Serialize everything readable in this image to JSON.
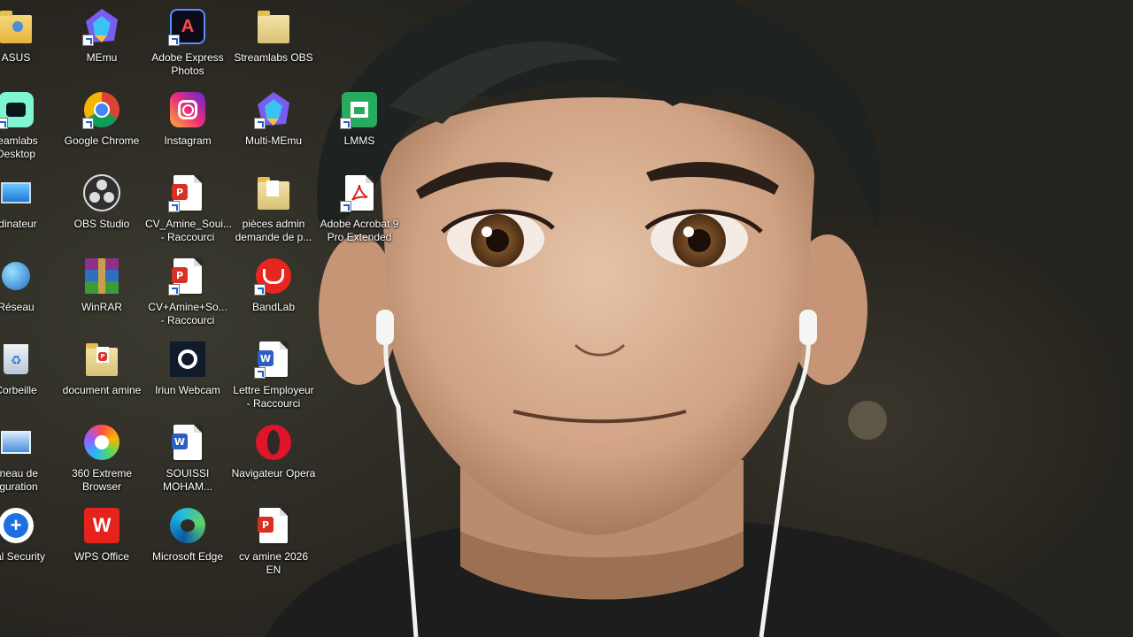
{
  "desktop": {
    "icons": [
      {
        "label": "ASUS",
        "icon": "user-folder-icon"
      },
      {
        "label": "MEmu",
        "icon": "memu-icon"
      },
      {
        "label": "Adobe Express\nPhotos",
        "icon": "adobe-express-icon"
      },
      {
        "label": "Streamlabs OBS",
        "icon": "folder-icon"
      },
      {
        "label": "reamlabs\nDesktop",
        "icon": "streamlabs-icon"
      },
      {
        "label": "Google Chrome",
        "icon": "chrome-icon"
      },
      {
        "label": "Instagram",
        "icon": "instagram-icon"
      },
      {
        "label": "Multi-MEmu",
        "icon": "memu-icon"
      },
      {
        "label": "LMMS",
        "icon": "lmms-icon"
      },
      {
        "label": "rdinateur",
        "icon": "computer-icon"
      },
      {
        "label": "OBS Studio",
        "icon": "obs-icon"
      },
      {
        "label": "CV_Amine_Soui...\n- Raccourci",
        "icon": "pdf-document-icon"
      },
      {
        "label": "pièces admin\ndemande de p...",
        "icon": "folder-icon"
      },
      {
        "label": "Adobe Acrobat 9\nPro Extended",
        "icon": "acrobat-icon"
      },
      {
        "label": "Réseau",
        "icon": "network-icon"
      },
      {
        "label": "WinRAR",
        "icon": "winrar-icon"
      },
      {
        "label": "CV+Amine+So...\n- Raccourci",
        "icon": "pdf-document-icon"
      },
      {
        "label": "BandLab",
        "icon": "bandlab-icon"
      },
      {
        "label": "Corbeille",
        "icon": "recycle-bin-icon"
      },
      {
        "label": "document amine",
        "icon": "folder-icon"
      },
      {
        "label": "Iriun Webcam",
        "icon": "webcam-icon"
      },
      {
        "label": "Lettre Employeur\n- Raccourci",
        "icon": "word-document-icon"
      },
      {
        "label": "nneau de\nfiguration",
        "icon": "control-panel-icon"
      },
      {
        "label": "360 Extreme\nBrowser",
        "icon": "browser-360-icon"
      },
      {
        "label": "SOUISSI\nMOHAM...",
        "icon": "word-document-icon"
      },
      {
        "label": "Navigateur Opera",
        "icon": "opera-icon"
      },
      {
        "label": "otal Security",
        "icon": "total-security-icon"
      },
      {
        "label": "WPS Office",
        "icon": "wps-icon"
      },
      {
        "label": "Microsoft Edge",
        "icon": "edge-icon"
      },
      {
        "label": "cv amine 2026 EN",
        "icon": "pdf-document-icon"
      }
    ]
  },
  "colors": {
    "label_text": "#ffffff",
    "wallpaper_dark": "#2a2822"
  }
}
